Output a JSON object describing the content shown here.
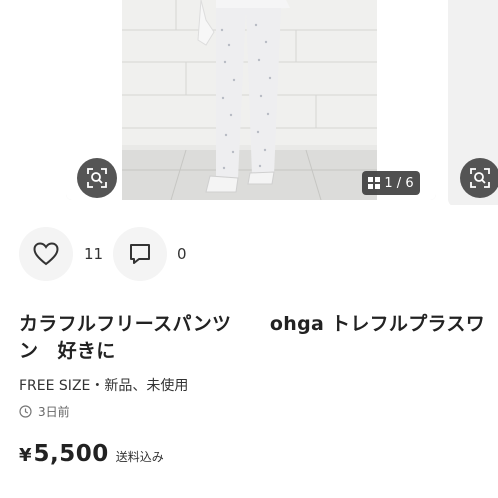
{
  "gallery": {
    "counter": "1 / 6",
    "zoom_icon": "zoom-search-icon",
    "counter_icon": "grid-icon"
  },
  "actions": {
    "like_icon": "heart-icon",
    "like_count": "11",
    "comment_icon": "comment-icon",
    "comment_count": "0"
  },
  "item": {
    "title": "カラフルフリースパンツ　　ohga トレフルプラスワン　好きに",
    "meta": "FREE SIZE・新品、未使用",
    "posted": "3日前",
    "currency": "¥",
    "price": "5,500",
    "shipping": "送料込み"
  },
  "colors": {
    "text": "#222222",
    "icon_bg": "#f4f4f4",
    "overlay": "#464646"
  }
}
